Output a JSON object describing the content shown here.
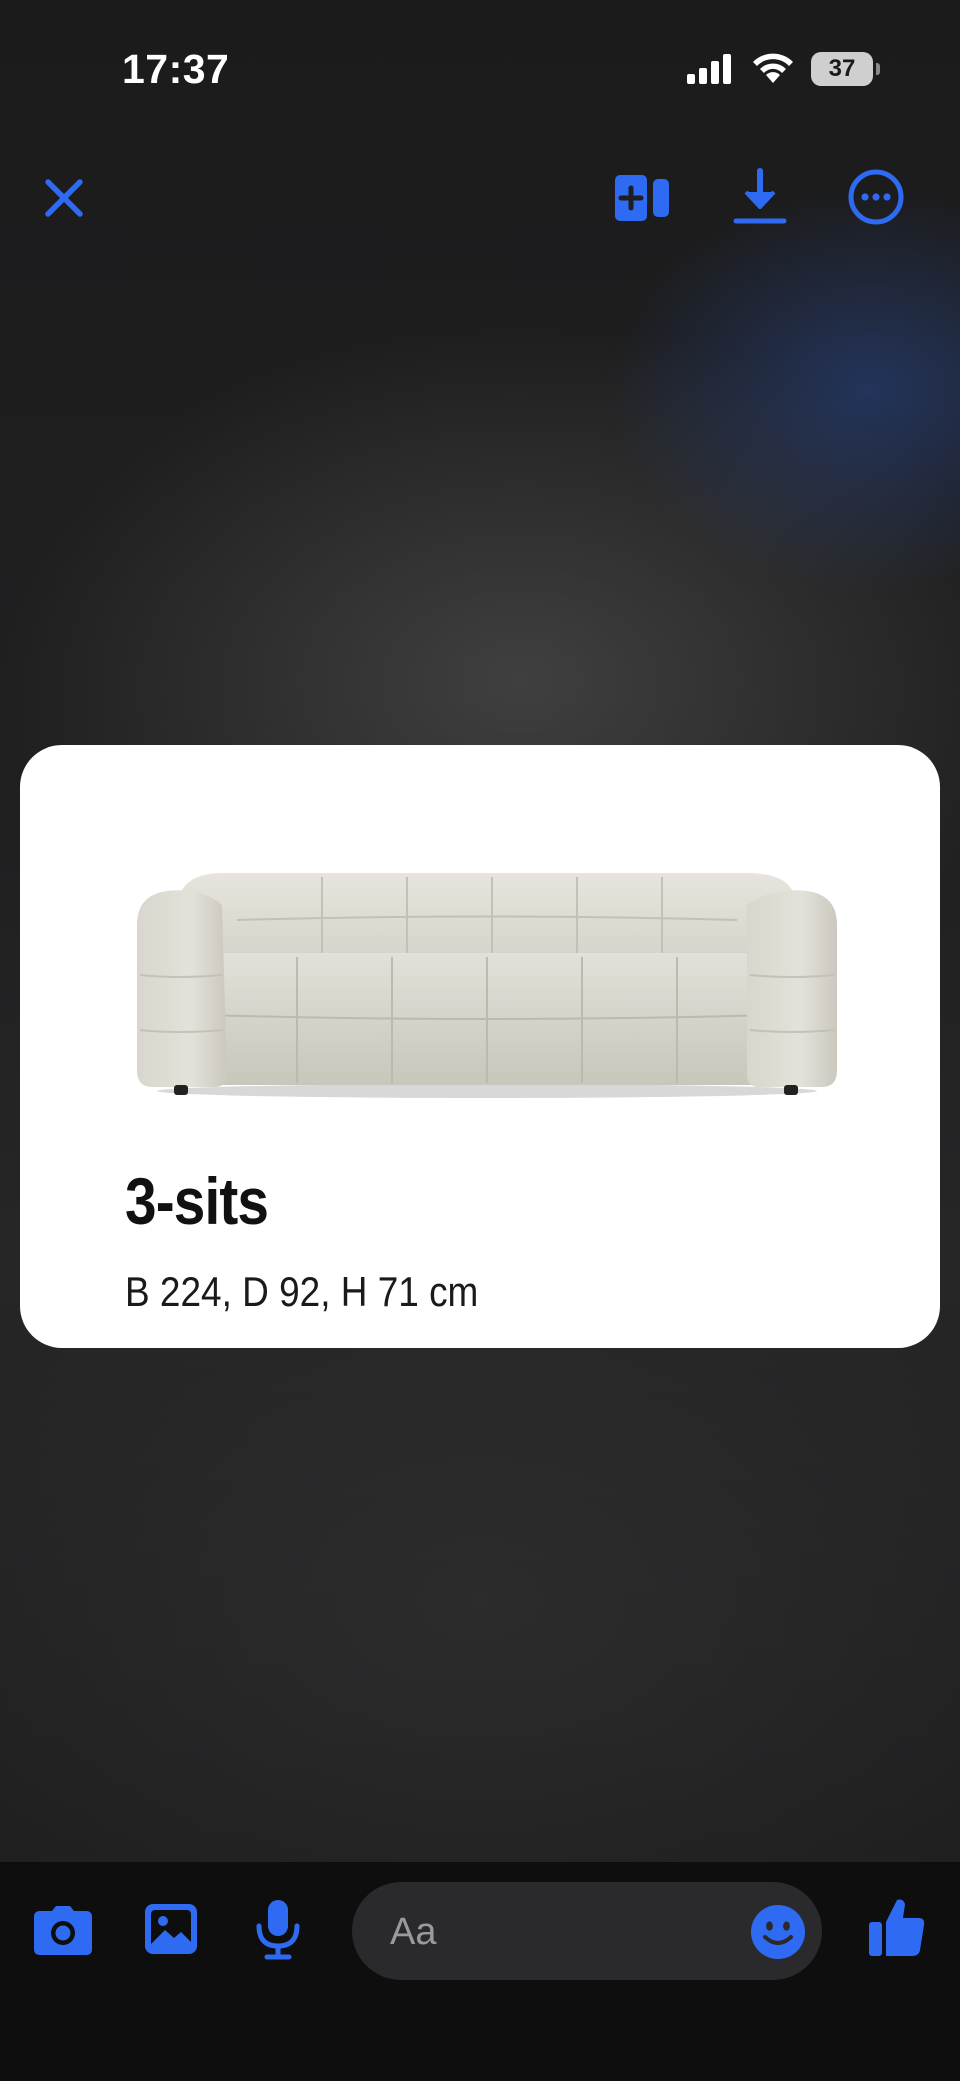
{
  "colors": {
    "accent": "#2f6bf2",
    "composer_bg": "#0e0e0f",
    "card_bg": "#ffffff"
  },
  "status_bar": {
    "time": "17:37",
    "battery_level": "37",
    "icons": [
      "cellular-signal-icon",
      "wifi-icon",
      "battery-icon"
    ]
  },
  "toolbar": {
    "icons": [
      "close-icon",
      "add-to-layout-icon",
      "download-icon",
      "more-options-icon"
    ]
  },
  "media_card": {
    "title": "3-sits",
    "dimensions": "B 224, D 92, H 71 cm",
    "image": "sofa-image"
  },
  "composer": {
    "placeholder": "Aa",
    "icons": [
      "camera-icon",
      "gallery-icon",
      "microphone-icon",
      "emoji-icon",
      "thumbs-up-icon"
    ]
  }
}
